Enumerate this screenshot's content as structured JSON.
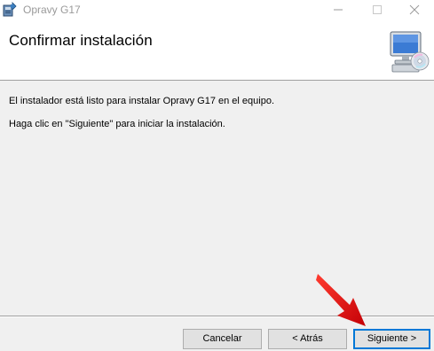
{
  "window": {
    "title": "Opravy G17",
    "icon": "installer-package-icon",
    "controls": [
      "minimize-icon",
      "maximize-icon",
      "close-icon"
    ]
  },
  "header": {
    "title": "Confirmar instalación",
    "icon": "computer-cd-icon"
  },
  "body": {
    "message_ready": "El instalador está listo para instalar Opravy G17 en el equipo.",
    "message_click": "Haga clic en \"Siguiente\" para iniciar la instalación."
  },
  "buttons": {
    "cancel_label": "Cancelar",
    "back_label": "< Atrás",
    "next_label": "Siguiente >"
  },
  "colors": {
    "focus_border": "#0078d7",
    "annotation_arrow": "#e8000b"
  }
}
